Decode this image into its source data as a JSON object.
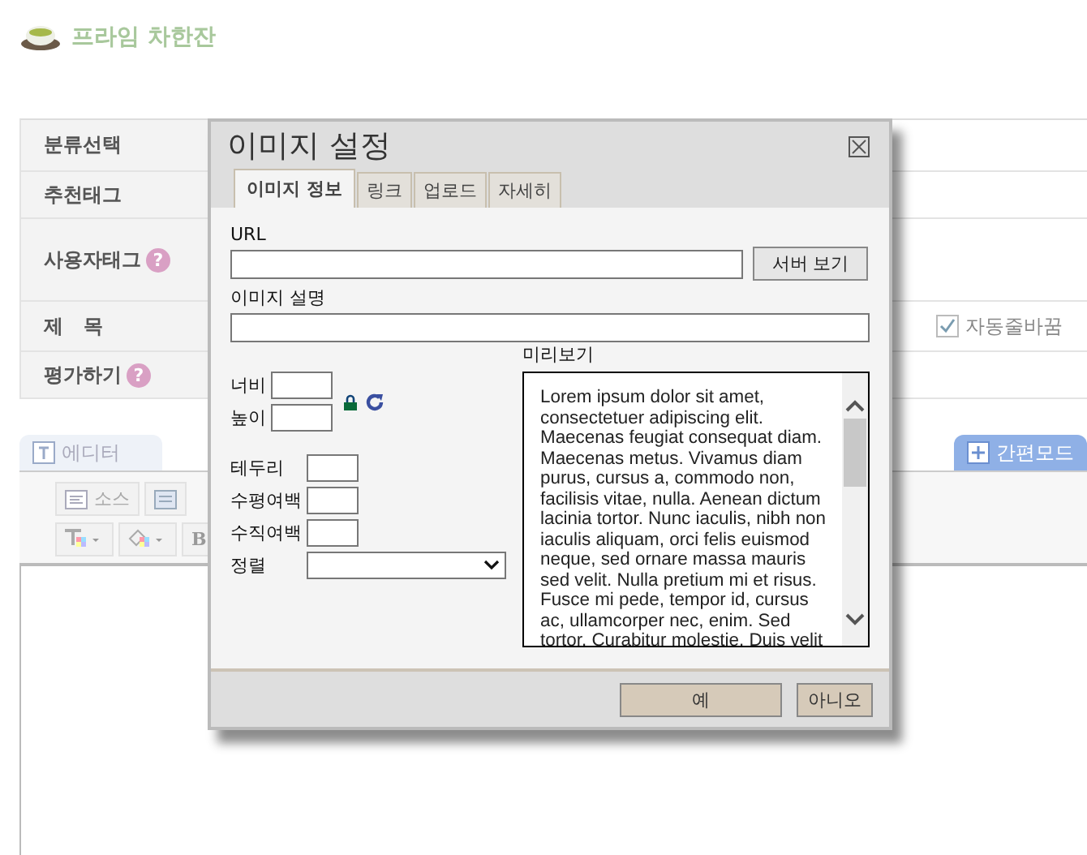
{
  "header": {
    "title": "프라임 차한잔"
  },
  "form": {
    "rows": [
      {
        "label": "분류선택"
      },
      {
        "label": "추천태그"
      },
      {
        "label": "사용자태그",
        "help": "?"
      },
      {
        "label": "제   목",
        "word_wrap": {
          "label": "자동줄바꿈",
          "checked": true
        }
      },
      {
        "label": "평가하기",
        "help": "?"
      }
    ]
  },
  "editor": {
    "tabs": [
      {
        "label": "에디터",
        "selected": false
      },
      {
        "label": "간편모드",
        "selected": true
      }
    ],
    "source_button": "소스",
    "bold_button": "B"
  },
  "dialog": {
    "title": "이미지 설정",
    "tabs": [
      {
        "label": "이미지 정보",
        "selected": true
      },
      {
        "label": "링크",
        "selected": false
      },
      {
        "label": "업로드",
        "selected": false
      },
      {
        "label": "자세히",
        "selected": false
      }
    ],
    "url": {
      "label": "URL"
    },
    "browse_button": "서버 보기",
    "description": {
      "label": "이미지 설명"
    },
    "size_fields": [
      {
        "label": "너비"
      },
      {
        "label": "높이"
      }
    ],
    "layout_fields": [
      {
        "label": "테두리"
      },
      {
        "label": "수평여백"
      },
      {
        "label": "수직여백"
      }
    ],
    "align": {
      "label": "정렬"
    },
    "preview": {
      "label": "미리보기",
      "text": "Lorem ipsum dolor sit amet, consectetuer adipiscing elit. Maecenas feugiat consequat diam. Maecenas metus. Vivamus diam purus, cursus a, commodo non, facilisis vitae, nulla. Aenean dictum lacinia tortor. Nunc iaculis, nibh non iaculis aliquam, orci felis euismod neque, sed ornare massa mauris sed velit. Nulla pretium mi et risus. Fusce mi pede, tempor id, cursus ac, ullamcorper nec, enim. Sed tortor. Curabitur molestie. Duis velit"
    },
    "buttons": [
      {
        "label": "예",
        "kind": "ok"
      },
      {
        "label": "아니오",
        "kind": "cancel"
      }
    ]
  }
}
